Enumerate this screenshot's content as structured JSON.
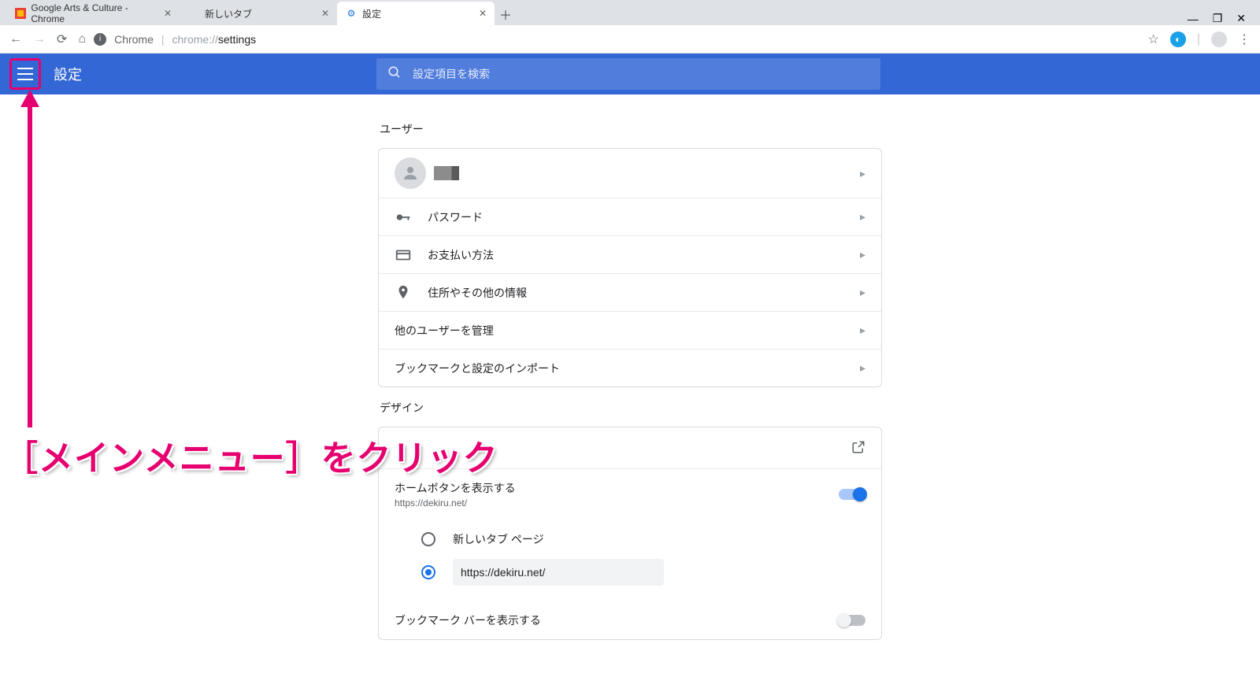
{
  "tabs": [
    {
      "title": "Google Arts & Culture - Chrome"
    },
    {
      "title": "新しいタブ"
    },
    {
      "title": "設定"
    }
  ],
  "addr": {
    "chrome": "Chrome",
    "url_prefix": "chrome://",
    "url_path": "settings"
  },
  "header": {
    "title": "設定",
    "search_placeholder": "設定項目を検索"
  },
  "user_section": {
    "title": "ユーザー",
    "password": "パスワード",
    "payment": "お支払い方法",
    "address": "住所やその他の情報",
    "manage": "他のユーザーを管理",
    "import": "ブックマークと設定のインポート"
  },
  "design_section": {
    "title": "デザイン",
    "home_button": "ホームボタンを表示する",
    "home_sub": "https://dekiru.net/",
    "radio_newtab": "新しいタブ ページ",
    "radio_url_value": "https://dekiru.net/",
    "bookmark_bar": "ブックマーク バーを表示する"
  },
  "callout": "［メインメニュー］をクリック"
}
